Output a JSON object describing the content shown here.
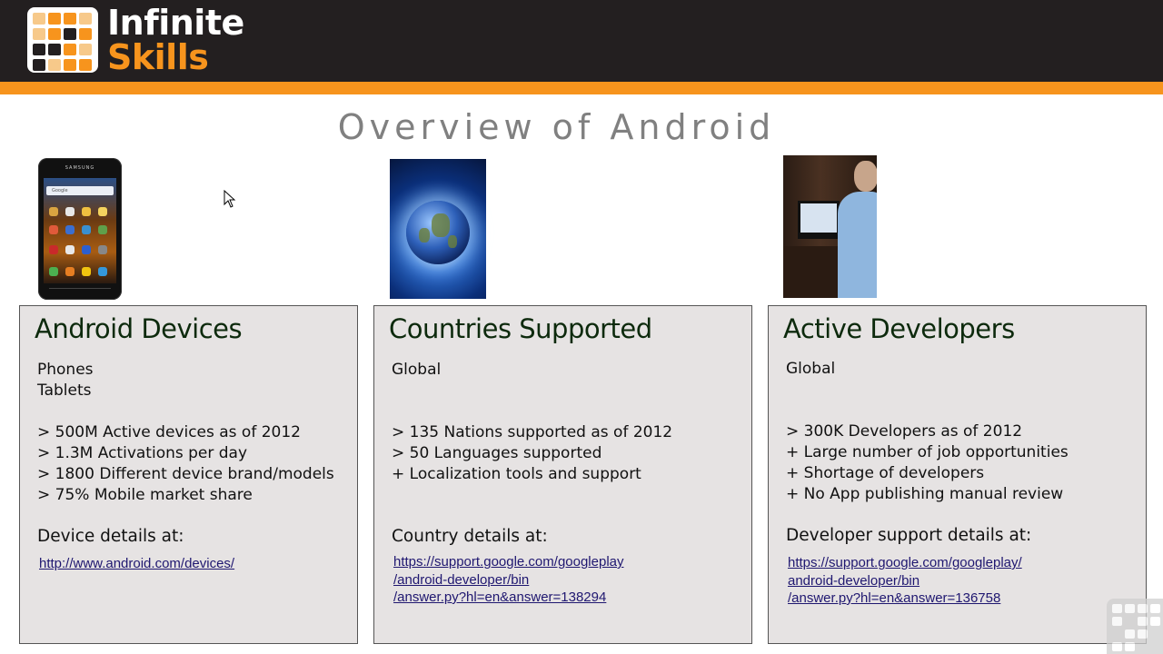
{
  "header": {
    "logo_line1": "Infinite",
    "logo_line2": "Skills",
    "brand_color": "#f7941d"
  },
  "slide": {
    "title": "Overview of Android"
  },
  "images": {
    "phone_brand": "SAMSUNG",
    "phone_search": "Google"
  },
  "panels": {
    "devices": {
      "heading": "Android Devices",
      "lines": [
        "Phones",
        "Tablets"
      ],
      "bullets": [
        "> 500M Active devices as of 2012",
        "> 1.3M Activations per day",
        "> 1800 Different device brand/models",
        "> 75% Mobile market share"
      ],
      "details_label": "Device details at:",
      "link_lines": [
        "http://www.android.com/devices/"
      ]
    },
    "countries": {
      "heading": "Countries Supported",
      "lines": [
        "Global"
      ],
      "bullets": [
        "> 135 Nations supported as of 2012",
        "> 50 Languages supported",
        "+ Localization tools and support"
      ],
      "details_label": "Country details at:",
      "link_lines": [
        "https://support.google.com/googleplay",
        "/android-developer/bin",
        "/answer.py?hl=en&answer=138294"
      ]
    },
    "developers": {
      "heading": "Active Developers",
      "lines": [
        "Global"
      ],
      "bullets": [
        "> 300K Developers as of 2012",
        "+ Large number of job opportunities",
        "+ Shortage of developers",
        "+ No App publishing manual review"
      ],
      "details_label": "Developer support details at:",
      "link_lines": [
        "https://support.google.com/googleplay/",
        "android-developer/bin",
        "/answer.py?hl=en&answer=136758"
      ]
    }
  }
}
